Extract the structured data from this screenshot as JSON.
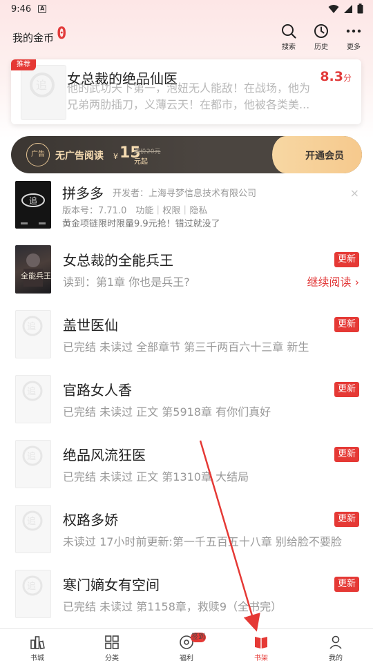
{
  "status_bar": {
    "time": "9:46",
    "app_icon": "A"
  },
  "header": {
    "coins_label": "我的金币",
    "coins_value": "0",
    "buttons": [
      {
        "label": "搜索",
        "icon": "search-icon"
      },
      {
        "label": "历史",
        "icon": "clock-icon"
      },
      {
        "label": "更多",
        "icon": "more-icon"
      }
    ]
  },
  "recommend": {
    "badge": "推荐",
    "title": "女总裁的绝品仙医",
    "score": "8.3",
    "score_unit": "分",
    "desc_line1": "他的武功天下第一，泡妞无人能敌！在战场，他为",
    "desc_line2": "兄弟两肋插刀，义薄云天！在都市，他被各类美..."
  },
  "vip": {
    "circle_text": "广告",
    "text": "无广告阅读",
    "currency": "¥",
    "price": "15",
    "original": "原价20元",
    "from": "元起",
    "open": "开通会员"
  },
  "ad": {
    "title": "拼多多",
    "developer": "开发者：上海寻梦信息技术有限公司",
    "meta": "版本号：7.71.0　功能｜权限｜隐私",
    "promo": "黄金项链限时限量9.9元抢！错过就没了",
    "close": "×"
  },
  "books": [
    {
      "title": "女总裁的全能兵王",
      "sub": "读到：第1章 你也是兵王?",
      "badge": "更新",
      "action": "继续阅读 ›"
    },
    {
      "title": "盖世医仙",
      "sub": "已完结 未读过 全部章节 第三千两百六十三章 新生",
      "badge": "更新"
    },
    {
      "title": "官路女人香",
      "sub": "已完结 未读过 正文 第5918章 有你们真好",
      "badge": "更新"
    },
    {
      "title": "绝品风流狂医",
      "sub": "已完结 未读过 正文 第1310章 大结局",
      "badge": "更新"
    },
    {
      "title": "权路多娇",
      "sub": "未读过 17小时前更新:第一千五百五十八章 别给脸不要脸",
      "badge": "更新"
    },
    {
      "title": "寒门嫡女有空间",
      "sub": "已完结 未读过 第1158章，救赎9（全书完）",
      "badge": "更新"
    }
  ],
  "nav": [
    {
      "label": "书城",
      "icon": "bookstore-icon"
    },
    {
      "label": "分类",
      "icon": "category-icon"
    },
    {
      "label": "福利",
      "icon": "welfare-icon",
      "badge": "签到"
    },
    {
      "label": "书架",
      "icon": "bookshelf-icon",
      "active": true
    },
    {
      "label": "我的",
      "icon": "profile-icon"
    }
  ],
  "colors": {
    "accent": "#e53935",
    "vip_dark": "#3b3632",
    "vip_gold": "#f6c98d"
  }
}
